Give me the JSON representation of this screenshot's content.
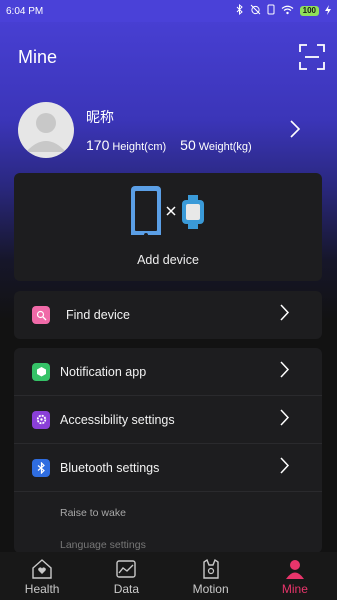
{
  "status_bar": {
    "time": "6:04 PM",
    "battery": "100"
  },
  "header": {
    "title": "Mine"
  },
  "profile": {
    "nickname": "昵称",
    "height_value": "170",
    "height_unit": "Height(cm)",
    "weight_value": "50",
    "weight_unit": "Weight(kg)"
  },
  "device": {
    "add_label": "Add device"
  },
  "menu": {
    "find_device": "Find device",
    "notification_app": "Notification app",
    "accessibility_settings": "Accessibility settings",
    "bluetooth_settings": "Bluetooth settings",
    "raise_to_wake": "Raise to wake",
    "language_settings": "Language settings"
  },
  "bottom_nav": {
    "items": [
      {
        "label": "Health"
      },
      {
        "label": "Data"
      },
      {
        "label": "Motion"
      },
      {
        "label": "Mine"
      }
    ],
    "active": "Mine"
  },
  "colors": {
    "accent": "#e8356b",
    "brand_gradient_top": "#4a41d8"
  }
}
